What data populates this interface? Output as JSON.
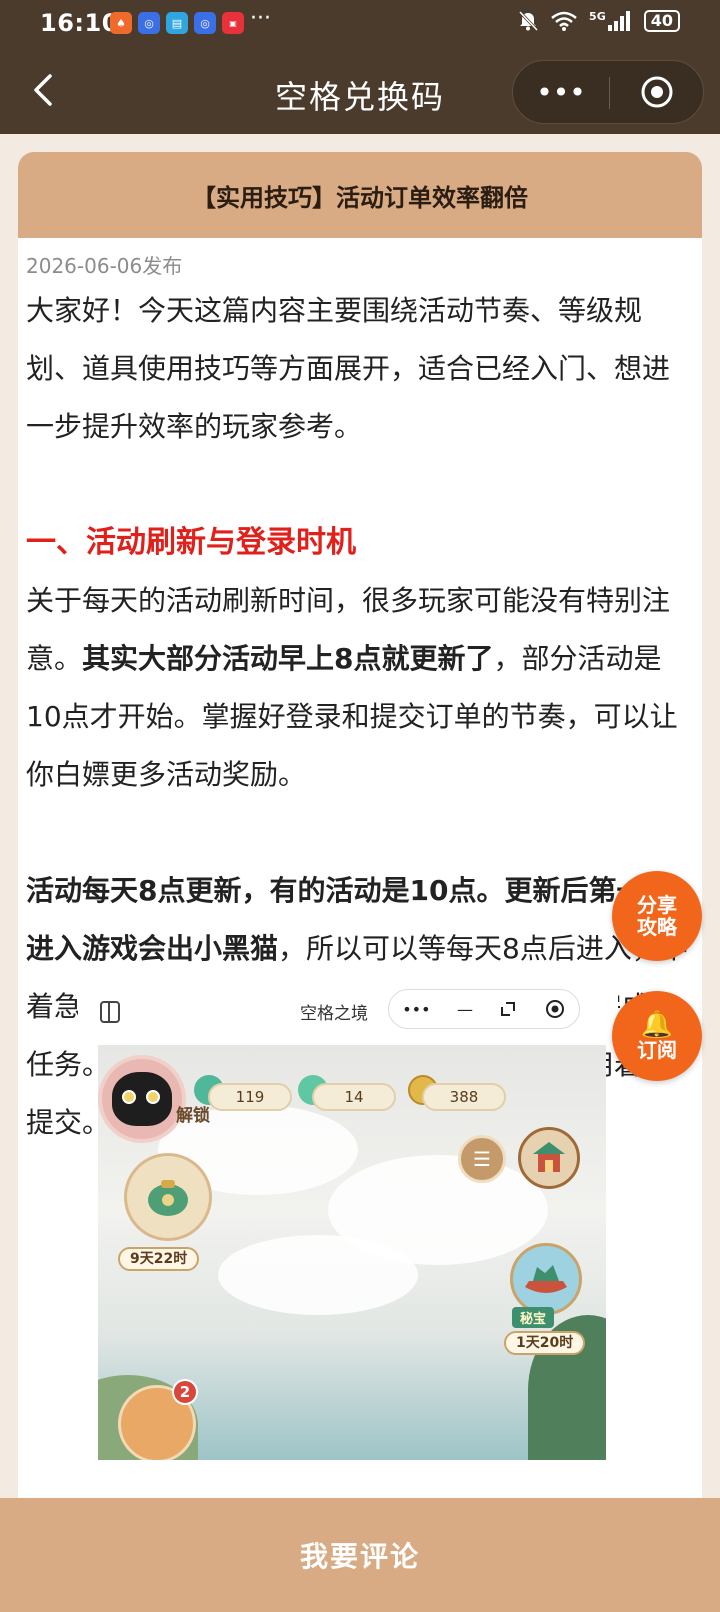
{
  "status_bar": {
    "time": "16:10",
    "more": "···",
    "network": "5G",
    "battery": "40"
  },
  "title_bar": {
    "title": "空格兑换码",
    "more_label": "•••"
  },
  "article": {
    "header_title": "【实用技巧】活动订单效率翻倍",
    "date": "2026-06-06发布",
    "intro": "大家好！今天这篇内容主要围绕活动节奏、等级规划、道具使用技巧等方面展开，适合已经入门、想进一步提升效率的玩家参考。",
    "section1_heading": "一、活动刷新与登录时机",
    "para2_a": "关于每天的活动刷新时间，很多玩家可能没有特别注意。",
    "para2_b": "其实大部分活动早上8点就更新了",
    "para2_c": "，部分活动是10点才开始。掌握好登录和提交订单的节奏，可以让你白嫖更多活动奖励。",
    "para3_a": "活动每天8点更新，有的活动是10点。更新后第一次进入游戏会出小黑猫",
    "para3_b": "，所以可以等每天8点后进入，不着急的可以等到10点，这时去提交前一天已经完成的任务。没有活动的时候尽量多完成任务，但不用着急提交。"
  },
  "embedded_screenshot": {
    "title": "空格之境",
    "capsule_more": "•••",
    "capsule_minus": "—",
    "resources": [
      "119",
      "14",
      "388"
    ],
    "sidebar_label": "解锁",
    "timer_left": "9天22时",
    "secret_label": "秘宝",
    "timer_right": "1天20时",
    "badge_count": "2"
  },
  "floating": {
    "share_line1": "分享",
    "share_line2": "攻略",
    "subscribe": "订阅",
    "bell": "🔔"
  },
  "bottom_bar": {
    "comment_label": "我要评论"
  },
  "colors": {
    "title_bar": "#4a3b2c",
    "header": "#d8ab84",
    "accent_red": "#e0201b",
    "float_orange": "#f2661c",
    "page_bg": "#f3ebe1"
  }
}
